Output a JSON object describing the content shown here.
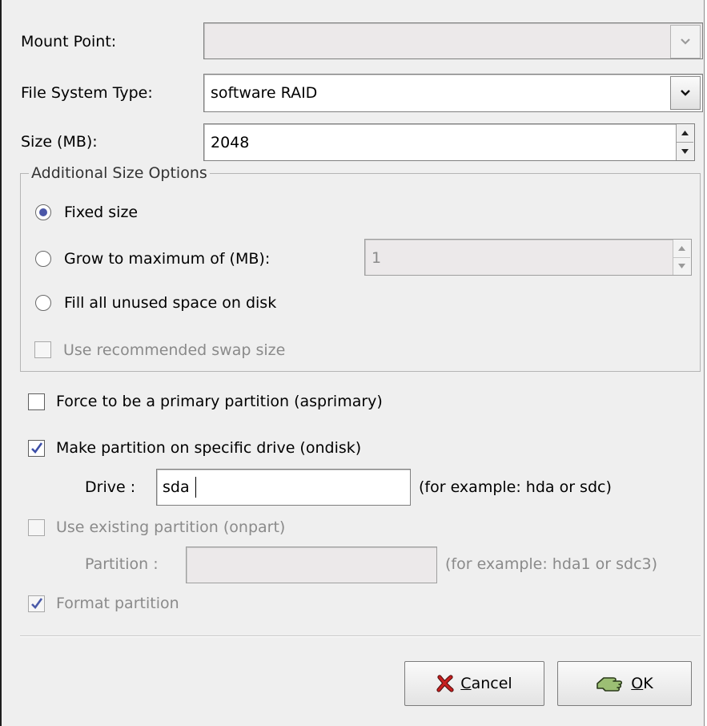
{
  "form": {
    "mount_point_label": "Mount Point:",
    "mount_point_value": "",
    "fs_type_label": "File System Type:",
    "fs_type_value": "software RAID",
    "size_label": "Size (MB):",
    "size_value": "2048"
  },
  "size_options": {
    "frame_title": "Additional Size Options",
    "fixed_size": "Fixed size",
    "grow_to_max": "Grow to maximum of (MB):",
    "grow_value": "1",
    "fill_all": "Fill all unused space on disk",
    "recommended_swap": "Use recommended swap size",
    "selected": "fixed_size"
  },
  "options": {
    "force_primary": "Force to be a primary partition (asprimary)",
    "force_primary_checked": false,
    "specific_drive": "Make partition on specific drive (ondisk)",
    "specific_drive_checked": true,
    "drive_label": "Drive :",
    "drive_value": "sda",
    "drive_hint": "(for example: hda or sdc)",
    "use_existing": "Use existing partition (onpart)",
    "use_existing_checked": false,
    "partition_label": "Partition :",
    "partition_value": "",
    "partition_hint": "(for example: hda1 or sdc3)",
    "format_partition": "Format partition",
    "format_partition_checked": true
  },
  "buttons": {
    "cancel_prefix": "",
    "cancel_mnemonic": "C",
    "cancel_rest": "ancel",
    "ok_mnemonic": "O",
    "ok_rest": "K"
  },
  "colors": {
    "dialog_bg": "#efefef",
    "radio_selected": "#4b57a8",
    "check_mark": "#3d4fa8",
    "cancel_icon": "#c62020",
    "ok_icon": "#8fb36a"
  },
  "icons": {
    "dropdown": "chevron-down-icon",
    "spin_up": "triangle-up-icon",
    "spin_down": "triangle-down-icon",
    "cancel": "red-x-icon",
    "ok": "hand-pointer-icon"
  }
}
